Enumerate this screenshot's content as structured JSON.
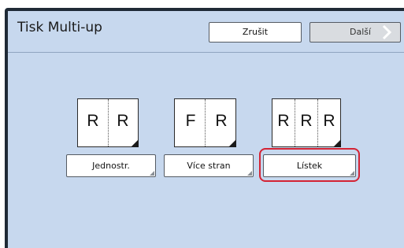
{
  "header": {
    "title": "Tisk Multi-up",
    "cancel_label": "Zrušit",
    "next_label": "Další"
  },
  "modes": [
    {
      "label": "Jednostr.",
      "letters": [
        "R",
        "R"
      ],
      "selected": false
    },
    {
      "label": "Více stran",
      "letters": [
        "F",
        "R"
      ],
      "selected": false
    },
    {
      "label": "Lístek",
      "letters": [
        "R",
        "R",
        "R"
      ],
      "selected": true
    }
  ],
  "colors": {
    "panel": "#c7d8ee",
    "frame": "#1f2a36",
    "selection": "#d42334"
  },
  "icons": {
    "next": "chevron-right-icon",
    "fold": "page-fold-icon"
  }
}
